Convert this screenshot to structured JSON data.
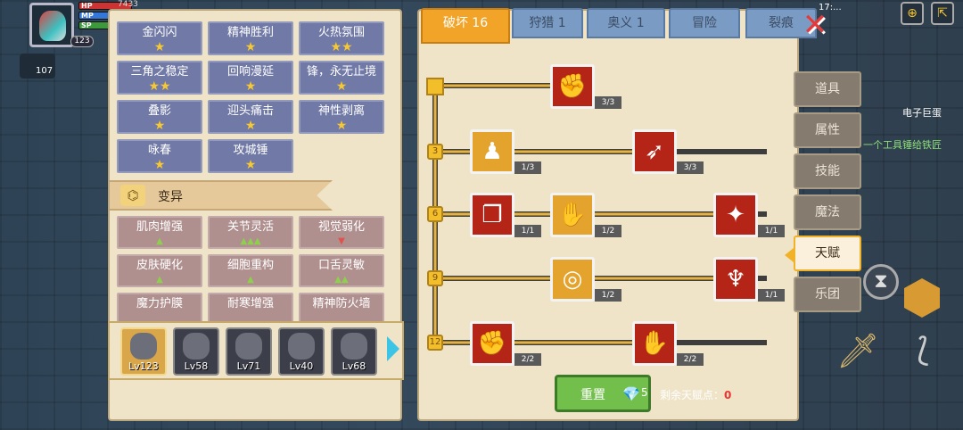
{
  "hud": {
    "level": "123",
    "hp_label": "HP",
    "mp_label": "MP",
    "sp_label": "SP",
    "side_count": "107",
    "hp_value": "7433"
  },
  "skills_top": [
    {
      "name": "金闪闪",
      "stars": "★"
    },
    {
      "name": "精神胜利",
      "stars": "★"
    },
    {
      "name": "火热氛围",
      "stars": "★★"
    },
    {
      "name": "三角之稳定",
      "stars": "★★"
    },
    {
      "name": "回响漫延",
      "stars": "★"
    },
    {
      "name": "锋，永无止境",
      "stars": "★"
    },
    {
      "name": "叠影",
      "stars": "★"
    },
    {
      "name": "迎头痛击",
      "stars": "★"
    },
    {
      "name": "神性剥离",
      "stars": "★"
    },
    {
      "name": "咏春",
      "stars": "★"
    },
    {
      "name": "攻城锤",
      "stars": "★"
    }
  ],
  "section": {
    "label": "变异"
  },
  "mutations": [
    {
      "name": "肌肉增强",
      "mark": "▲",
      "type": "g"
    },
    {
      "name": "关节灵活",
      "mark": "▲▲▲",
      "type": "g"
    },
    {
      "name": "视觉弱化",
      "mark": "▼",
      "type": "r"
    },
    {
      "name": "皮肤硬化",
      "mark": "▲",
      "type": "g"
    },
    {
      "name": "细胞重构",
      "mark": "▲",
      "type": "g"
    },
    {
      "name": "口舌灵敏",
      "mark": "▲▲",
      "type": "g"
    },
    {
      "name": "魔力护膜",
      "mark": "",
      "type": "g"
    },
    {
      "name": "耐寒增强",
      "mark": "",
      "type": "g"
    },
    {
      "name": "精神防火墙",
      "mark": "",
      "type": "g"
    }
  ],
  "characters": [
    {
      "lv": "Lv123"
    },
    {
      "lv": "Lv58"
    },
    {
      "lv": "Lv71"
    },
    {
      "lv": "Lv40"
    },
    {
      "lv": "Lv68"
    }
  ],
  "tabs": [
    {
      "label": "破坏 16"
    },
    {
      "label": "狩猎 1"
    },
    {
      "label": "奥义 1"
    },
    {
      "label": "冒险"
    },
    {
      "label": "裂痕"
    }
  ],
  "tree": {
    "levels": [
      "3",
      "6",
      "9",
      "12"
    ],
    "nodes": [
      {
        "icon": "✊",
        "count": "3/3",
        "color": "red"
      },
      {
        "icon": "♟",
        "count": "1/3",
        "color": "org"
      },
      {
        "icon": "➶",
        "count": "3/3",
        "color": "red"
      },
      {
        "icon": "❐",
        "count": "1/1",
        "color": "red"
      },
      {
        "icon": "✋",
        "count": "1/2",
        "color": "org"
      },
      {
        "icon": "✦",
        "count": "1/1",
        "color": "red"
      },
      {
        "icon": "◎",
        "count": "1/2",
        "color": "org"
      },
      {
        "icon": "♆",
        "count": "1/1",
        "color": "red"
      },
      {
        "icon": "✊",
        "count": "2/2",
        "color": "red"
      },
      {
        "icon": "✋",
        "count": "2/2",
        "color": "red"
      }
    ]
  },
  "reset": {
    "label": "重置",
    "gem": "💎",
    "cost": "5"
  },
  "remaining": {
    "label": "剩余天赋点：",
    "value": "0"
  },
  "side_tabs": [
    {
      "label": "道具"
    },
    {
      "label": "属性"
    },
    {
      "label": "技能"
    },
    {
      "label": "魔法"
    },
    {
      "label": "天赋"
    },
    {
      "label": "乐团"
    }
  ],
  "world": {
    "npc_name": "电子巨蛋",
    "hint": "一个工具锤给铁匠",
    "time": "17:..."
  }
}
